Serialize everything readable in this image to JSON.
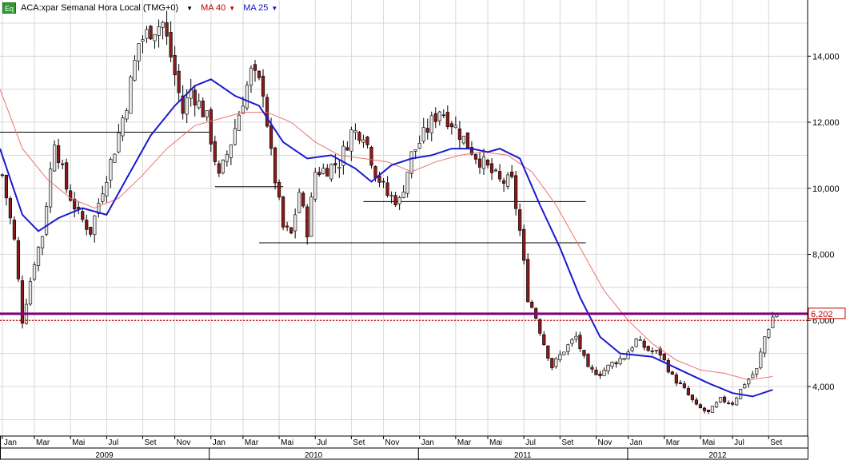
{
  "header": {
    "symbol_badge": "Eq",
    "title": "ACA:xpar Semanal Hora Local (TMG+0)",
    "ma40_label": "MA 40",
    "ma25_label": "MA 25"
  },
  "colors": {
    "up_candle": "#e6e6e6",
    "down_candle": "#8b1a1a",
    "ma25": "#1a1ad0",
    "ma40": "#f07070",
    "price_line": "#800080",
    "current_price_line": "#c00000",
    "grid": "#d8d8d8"
  },
  "chart_data": {
    "type": "candlestick",
    "title": "",
    "y_axis": {
      "min": 2500,
      "max": 15700,
      "ticks": [
        4000,
        6000,
        8000,
        10000,
        12000,
        14000
      ],
      "tick_labels": [
        "4,000",
        "6,000",
        "8,000",
        "10,000",
        "12,000",
        "14,000"
      ],
      "side": "right"
    },
    "x_axis": {
      "start": "2009-01-01",
      "end": "2012-11-10",
      "month_labels": [
        {
          "date": "2009-01-05",
          "label": "Jan"
        },
        {
          "date": "2009-03-02",
          "label": "Mar"
        },
        {
          "date": "2009-05-04",
          "label": "Mai"
        },
        {
          "date": "2009-07-06",
          "label": "Jul"
        },
        {
          "date": "2009-09-07",
          "label": "Set"
        },
        {
          "date": "2009-11-02",
          "label": "Nov"
        },
        {
          "date": "2010-01-04",
          "label": "Jan"
        },
        {
          "date": "2010-03-01",
          "label": "Mar"
        },
        {
          "date": "2010-05-03",
          "label": "Mai"
        },
        {
          "date": "2010-07-05",
          "label": "Jul"
        },
        {
          "date": "2010-09-06",
          "label": "Set"
        },
        {
          "date": "2010-11-01",
          "label": "Nov"
        },
        {
          "date": "2011-01-03",
          "label": "Jan"
        },
        {
          "date": "2011-03-07",
          "label": "Mar"
        },
        {
          "date": "2011-05-02",
          "label": "Mai"
        },
        {
          "date": "2011-07-04",
          "label": "Jul"
        },
        {
          "date": "2011-09-05",
          "label": "Set"
        },
        {
          "date": "2011-11-07",
          "label": "Nov"
        },
        {
          "date": "2012-01-02",
          "label": "Jan"
        },
        {
          "date": "2012-03-05",
          "label": "Mar"
        },
        {
          "date": "2012-05-07",
          "label": "Mai"
        },
        {
          "date": "2012-07-02",
          "label": "Jul"
        },
        {
          "date": "2012-09-03",
          "label": "Set"
        }
      ],
      "year_labels": [
        {
          "start": "2009-01-01",
          "end": "2009-12-31",
          "label": "2009"
        },
        {
          "start": "2010-01-01",
          "end": "2010-12-31",
          "label": "2010"
        },
        {
          "start": "2011-01-01",
          "end": "2011-12-31",
          "label": "2011"
        },
        {
          "start": "2012-01-01",
          "end": "2012-11-10",
          "label": "2012"
        }
      ]
    },
    "grid": true,
    "last_price": 6202,
    "last_price_label": "6,202",
    "price_lines": [
      {
        "value": 6202,
        "style": "solid",
        "color": "price_line"
      },
      {
        "value": 6000,
        "style": "dotted",
        "color": "current_price_line"
      }
    ],
    "horizontal_lines": [
      {
        "from": "2009-01-01",
        "to": "2010-01-01",
        "value": 11700
      },
      {
        "from": "2010-01-11",
        "to": "2010-05-10",
        "value": 10050
      },
      {
        "from": "2010-09-27",
        "to": "2011-10-20",
        "value": 9600
      },
      {
        "from": "2010-03-29",
        "to": "2011-10-20",
        "value": 8350
      }
    ],
    "anchors": [
      [
        "2009-01-05",
        10400
      ],
      [
        "2009-01-26",
        8400
      ],
      [
        "2009-02-09",
        6000
      ],
      [
        "2009-03-02",
        7800
      ],
      [
        "2009-03-16",
        8600
      ],
      [
        "2009-04-06",
        11500
      ],
      [
        "2009-04-27",
        10000
      ],
      [
        "2009-05-18",
        9200
      ],
      [
        "2009-06-08",
        8700
      ],
      [
        "2009-06-29",
        10000
      ],
      [
        "2009-07-20",
        11200
      ],
      [
        "2009-08-10",
        12600
      ],
      [
        "2009-08-31",
        14400
      ],
      [
        "2009-09-21",
        14800
      ],
      [
        "2009-10-12",
        15000
      ],
      [
        "2009-10-26",
        14000
      ],
      [
        "2009-11-16",
        12300
      ],
      [
        "2009-11-30",
        13000
      ],
      [
        "2009-12-28",
        12100
      ],
      [
        "2010-01-18",
        10300
      ],
      [
        "2010-02-08",
        11400
      ],
      [
        "2010-03-01",
        12700
      ],
      [
        "2010-03-15",
        13500
      ],
      [
        "2010-04-05",
        13000
      ],
      [
        "2010-04-19",
        11000
      ],
      [
        "2010-05-10",
        8800
      ],
      [
        "2010-05-24",
        8600
      ],
      [
        "2010-06-07",
        9900
      ],
      [
        "2010-06-21",
        8700
      ],
      [
        "2010-07-05",
        10500
      ],
      [
        "2010-07-26",
        10600
      ],
      [
        "2010-08-16",
        10800
      ],
      [
        "2010-09-06",
        11700
      ],
      [
        "2010-09-27",
        11700
      ],
      [
        "2010-10-18",
        10500
      ],
      [
        "2010-11-08",
        9800
      ],
      [
        "2010-11-29",
        9600
      ],
      [
        "2010-12-20",
        11000
      ],
      [
        "2011-01-10",
        11600
      ],
      [
        "2011-02-07",
        12400
      ],
      [
        "2011-02-28",
        12000
      ],
      [
        "2011-03-21",
        11500
      ],
      [
        "2011-04-11",
        11000
      ],
      [
        "2011-05-02",
        10600
      ],
      [
        "2011-05-23",
        10200
      ],
      [
        "2011-06-13",
        10200
      ],
      [
        "2011-06-27",
        8700
      ],
      [
        "2011-07-11",
        6700
      ],
      [
        "2011-07-25",
        6100
      ],
      [
        "2011-08-08",
        5300
      ],
      [
        "2011-08-22",
        4600
      ],
      [
        "2011-09-12",
        5100
      ],
      [
        "2011-10-03",
        5500
      ],
      [
        "2011-10-24",
        4500
      ],
      [
        "2011-11-14",
        4400
      ],
      [
        "2011-12-05",
        4700
      ],
      [
        "2011-12-26",
        4900
      ],
      [
        "2012-01-16",
        5400
      ],
      [
        "2012-02-06",
        5100
      ],
      [
        "2012-02-27",
        5000
      ],
      [
        "2012-03-19",
        4300
      ],
      [
        "2012-04-09",
        3900
      ],
      [
        "2012-04-30",
        3400
      ],
      [
        "2012-05-21",
        3200
      ],
      [
        "2012-06-11",
        3600
      ],
      [
        "2012-07-02",
        3500
      ],
      [
        "2012-07-23",
        4100
      ],
      [
        "2012-08-13",
        4500
      ],
      [
        "2012-08-27",
        5500
      ],
      [
        "2012-09-10",
        6100
      ],
      [
        "2012-09-17",
        6200
      ]
    ],
    "ma25": [
      [
        "2009-01-01",
        11200
      ],
      [
        "2009-02-09",
        9200
      ],
      [
        "2009-03-09",
        8700
      ],
      [
        "2009-04-13",
        9100
      ],
      [
        "2009-05-25",
        9400
      ],
      [
        "2009-07-06",
        9200
      ],
      [
        "2009-08-10",
        10300
      ],
      [
        "2009-09-21",
        11600
      ],
      [
        "2009-11-02",
        12500
      ],
      [
        "2009-12-07",
        13100
      ],
      [
        "2010-01-04",
        13300
      ],
      [
        "2010-02-15",
        12800
      ],
      [
        "2010-03-29",
        12500
      ],
      [
        "2010-05-10",
        11400
      ],
      [
        "2010-06-21",
        10900
      ],
      [
        "2010-08-02",
        11000
      ],
      [
        "2010-09-13",
        10600
      ],
      [
        "2010-10-11",
        10200
      ],
      [
        "2010-11-15",
        10700
      ],
      [
        "2010-12-20",
        10900
      ],
      [
        "2011-01-24",
        11000
      ],
      [
        "2011-02-28",
        11200
      ],
      [
        "2011-04-04",
        11200
      ],
      [
        "2011-05-02",
        11100
      ],
      [
        "2011-05-23",
        11200
      ],
      [
        "2011-06-27",
        10900
      ],
      [
        "2011-08-01",
        9500
      ],
      [
        "2011-09-05",
        8200
      ],
      [
        "2011-10-10",
        6700
      ],
      [
        "2011-11-14",
        5500
      ],
      [
        "2011-12-19",
        5000
      ],
      [
        "2012-02-13",
        4900
      ],
      [
        "2012-04-02",
        4500
      ],
      [
        "2012-05-21",
        4100
      ],
      [
        "2012-07-02",
        3800
      ],
      [
        "2012-08-06",
        3700
      ],
      [
        "2012-09-10",
        3900
      ]
    ],
    "ma40": [
      [
        "2009-01-01",
        13000
      ],
      [
        "2009-02-09",
        11200
      ],
      [
        "2009-03-23",
        10300
      ],
      [
        "2009-05-04",
        9700
      ],
      [
        "2009-06-15",
        9400
      ],
      [
        "2009-07-27",
        9700
      ],
      [
        "2009-09-07",
        10400
      ],
      [
        "2009-10-19",
        11200
      ],
      [
        "2009-12-07",
        11900
      ],
      [
        "2010-01-18",
        12100
      ],
      [
        "2010-03-01",
        12300
      ],
      [
        "2010-04-12",
        12300
      ],
      [
        "2010-05-24",
        12000
      ],
      [
        "2010-07-05",
        11400
      ],
      [
        "2010-08-16",
        11000
      ],
      [
        "2010-09-27",
        10900
      ],
      [
        "2010-11-08",
        10800
      ],
      [
        "2010-12-20",
        10500
      ],
      [
        "2011-01-31",
        10800
      ],
      [
        "2011-03-14",
        11000
      ],
      [
        "2011-04-25",
        11100
      ],
      [
        "2011-06-06",
        11000
      ],
      [
        "2011-07-18",
        10500
      ],
      [
        "2011-08-29",
        9500
      ],
      [
        "2011-10-10",
        8200
      ],
      [
        "2011-11-21",
        6900
      ],
      [
        "2012-01-02",
        6000
      ],
      [
        "2012-02-13",
        5300
      ],
      [
        "2012-03-26",
        4800
      ],
      [
        "2012-05-07",
        4500
      ],
      [
        "2012-06-18",
        4400
      ],
      [
        "2012-07-30",
        4200
      ],
      [
        "2012-09-10",
        4300
      ]
    ]
  }
}
